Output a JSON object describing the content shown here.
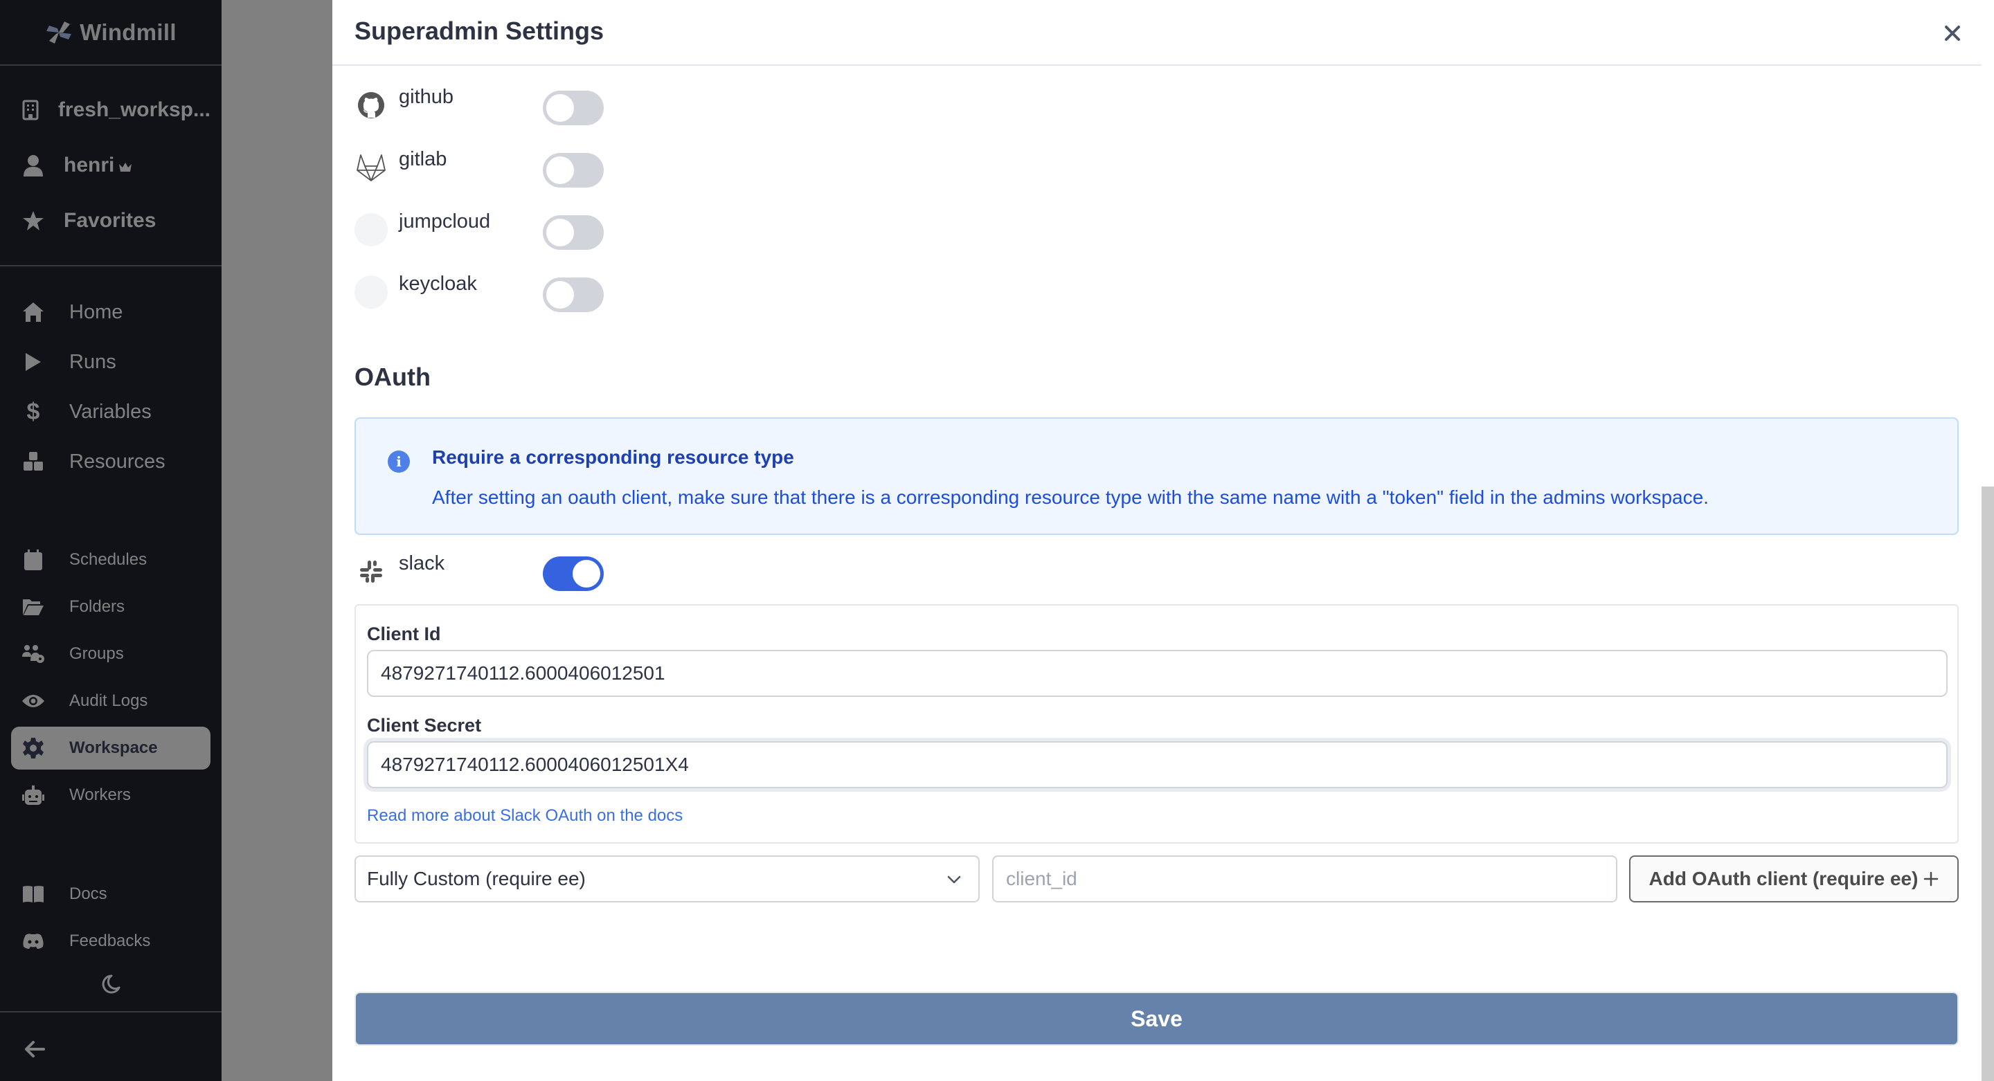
{
  "sidebar": {
    "brand": "Windmill",
    "workspace": "fresh_worksp...",
    "user": "henri",
    "user_badge_icon": "crown-icon",
    "favorites": "Favorites",
    "main_items": [
      {
        "label": "Home",
        "icon": "home-icon"
      },
      {
        "label": "Runs",
        "icon": "play-icon"
      },
      {
        "label": "Variables",
        "icon": "dollar-icon"
      },
      {
        "label": "Resources",
        "icon": "cubes-icon"
      }
    ],
    "sub_items": [
      {
        "label": "Schedules",
        "icon": "calendar-icon"
      },
      {
        "label": "Folders",
        "icon": "folder-open-icon"
      },
      {
        "label": "Groups",
        "icon": "users-cog-icon"
      },
      {
        "label": "Audit Logs",
        "icon": "eye-icon"
      },
      {
        "label": "Workspace",
        "icon": "gear-icon",
        "active": true
      },
      {
        "label": "Workers",
        "icon": "robot-icon"
      }
    ],
    "bottom_items": [
      {
        "label": "Docs",
        "icon": "book-icon"
      },
      {
        "label": "Feedbacks",
        "icon": "discord-icon"
      }
    ],
    "theme_toggle_icon": "moon-icon",
    "collapse_icon": "arrow-left-icon"
  },
  "drawer": {
    "title": "Superadmin Settings",
    "close_icon": "close-icon",
    "auth_providers": [
      {
        "name": "github",
        "enabled": false,
        "icon": "github-icon"
      },
      {
        "name": "gitlab",
        "enabled": false,
        "icon": "gitlab-icon"
      },
      {
        "name": "jumpcloud",
        "enabled": false,
        "icon": "blank-icon"
      },
      {
        "name": "keycloak",
        "enabled": false,
        "icon": "blank-icon"
      }
    ],
    "oauth": {
      "section_title": "OAuth",
      "alert": {
        "title": "Require a corresponding resource type",
        "body": "After setting an oauth client, make sure that there is a corresponding resource type with the same name with a \"token\" field in the admins workspace."
      },
      "slack": {
        "name": "slack",
        "enabled": true,
        "client_id_label": "Client Id",
        "client_id_value": "4879271740112.6000406012501",
        "client_secret_label": "Client Secret",
        "client_secret_value": "4879271740112.6000406012501X4",
        "docs_link": "Read more about Slack OAuth on the docs"
      },
      "custom_select_value": "Fully Custom (require ee)",
      "client_id_placeholder": "client_id",
      "add_button_label": "Add OAuth client (require ee)"
    },
    "save_label": "Save"
  },
  "colors": {
    "accent": "#3563e0",
    "save_button": "#6582aa",
    "sidebar_bg": "#111218",
    "info_bg": "#eff6ff"
  }
}
